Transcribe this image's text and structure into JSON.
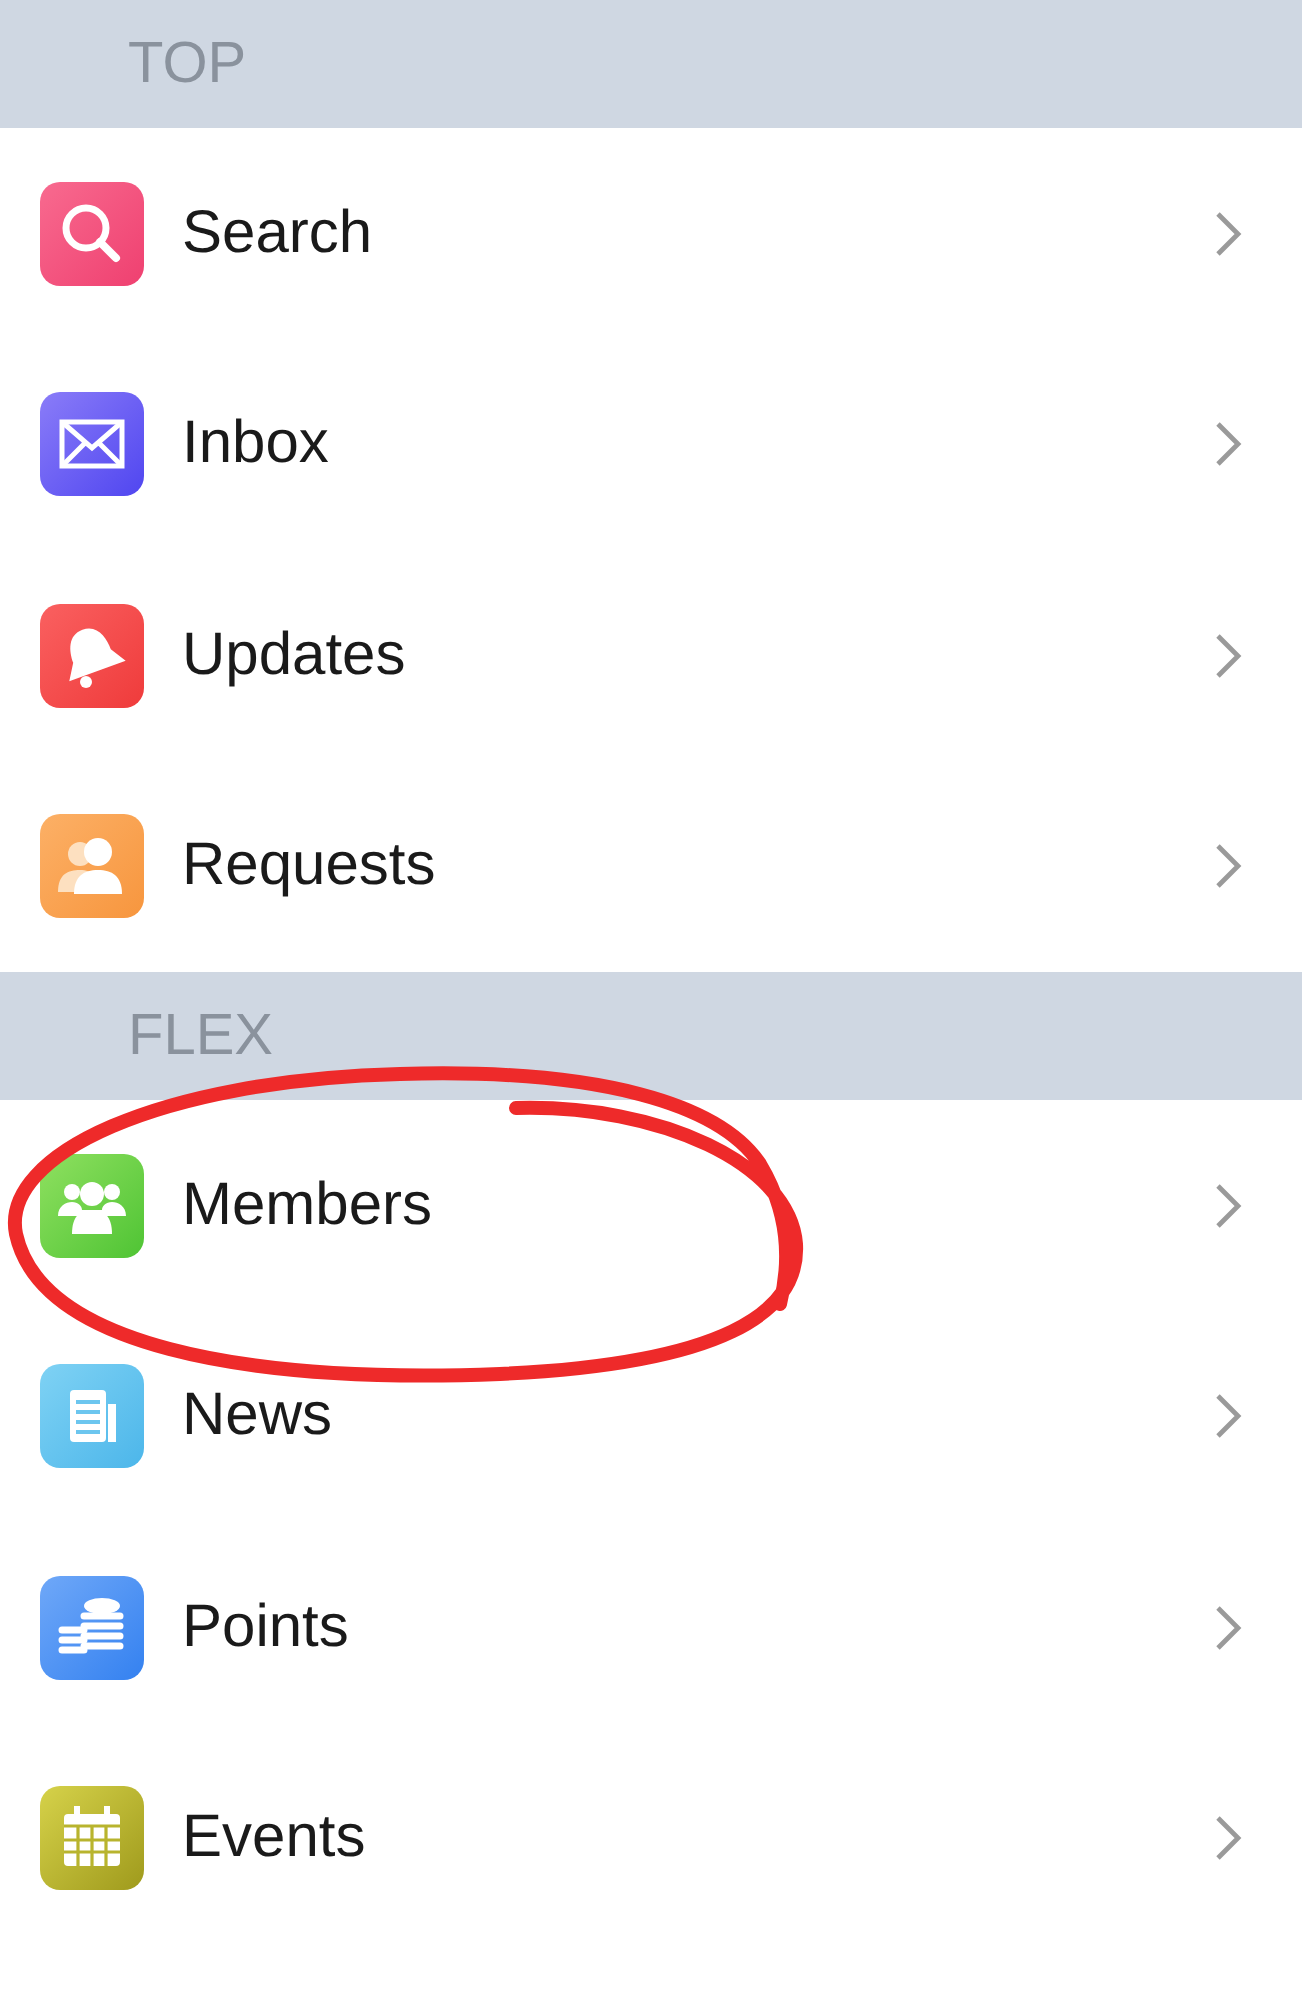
{
  "sections": [
    {
      "title": "TOP",
      "items": [
        {
          "kind": "search",
          "label": "Search",
          "circled": false
        },
        {
          "kind": "mail",
          "label": "Inbox",
          "circled": false
        },
        {
          "kind": "bell",
          "label": "Updates",
          "circled": false
        },
        {
          "kind": "contacts",
          "label": "Requests",
          "circled": false
        }
      ]
    },
    {
      "title": "FLEX",
      "items": [
        {
          "kind": "group",
          "label": "Members",
          "circled": true
        },
        {
          "kind": "news",
          "label": "News",
          "circled": false
        },
        {
          "kind": "coins",
          "label": "Points",
          "circled": false
        },
        {
          "kind": "calendar",
          "label": "Events",
          "circled": false
        }
      ]
    }
  ]
}
